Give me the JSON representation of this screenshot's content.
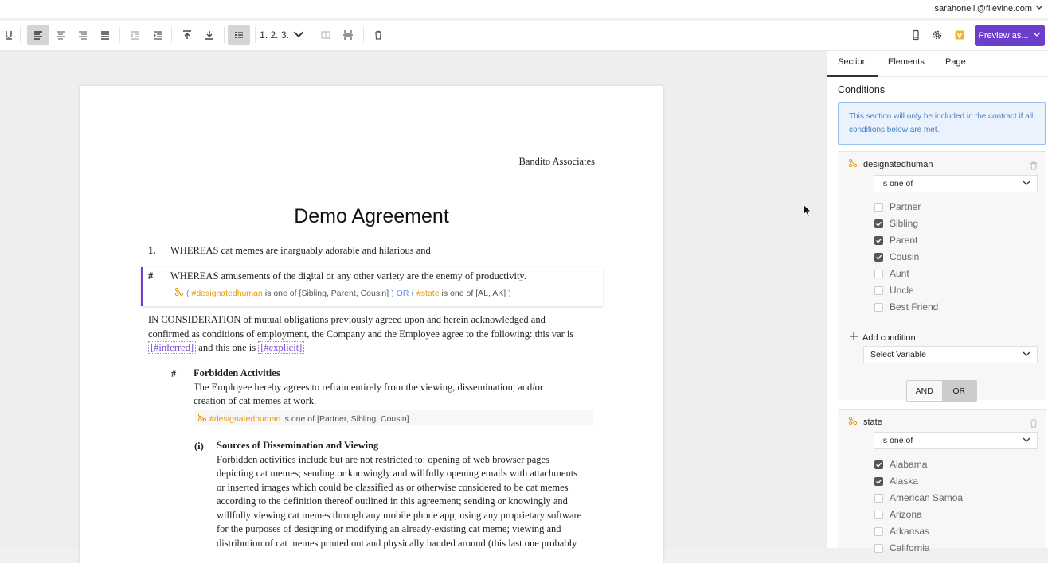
{
  "topbar": {
    "user_email": "sarahoneill@filevine.com"
  },
  "toolbar": {
    "list_style": "1. 2. 3.",
    "preview_label": "Preview as...",
    "accent": "#6b3fc9"
  },
  "document": {
    "company": "Bandito Associates",
    "title": "Demo Agreement",
    "p1_num": "1.",
    "p1_text": "WHEREAS cat memes are inarguably adorable and hilarious and",
    "p2_num": "#",
    "p2_text": "WHEREAS amusements of the digital or any other variety are the enemy of productivity.",
    "p2_cond": {
      "open": "(",
      "var1": "#designatedhuman",
      "op1": "is one of",
      "val1": "[Sibling, Parent, Cousin]",
      "close1": ")",
      "join": "OR",
      "open2": "(",
      "var2": "#state",
      "op2": "is one of",
      "val2": "[AL, AK]",
      "close2": ")"
    },
    "p3_line1": "IN CONSIDERATION of mutual obligations previously agreed upon and herein acknowledged and",
    "p3_line2": "confirmed as conditions of employment, the Company and the Employee agree to the following: this var is",
    "p3_var1": "[#inferred]",
    "p3_mid": "and this one is",
    "p3_var2": "[#explicit]",
    "p4_num": "#",
    "p4_heading": "Forbidden Activities",
    "p4_line1": "The Employee hereby agrees to refrain entirely from the viewing, dissemination, and/or",
    "p4_line2": "creation of cat memes at work.",
    "p4_cond": {
      "var": "#designatedhuman",
      "op": "is one of",
      "val": "[Partner, Sibling, Cousin]"
    },
    "p5_num": "(i)",
    "p5_heading": "Sources of Dissemination and Viewing",
    "p5_lines": [
      "Forbidden activities include but are not restricted to: opening of web browser pages",
      "depicting cat memes; sending or knowingly and willfully opening emails with attachments",
      "or inserted images which could be classified as or otherwise considered to be cat memes",
      "according to the definition thereof outlined in this agreement; sending or knowingly and",
      "willfully viewing cat memes through any mobile phone app; using any proprietary software",
      "for the purposes of designing or modifying an already-existing cat meme; viewing and",
      "distribution of cat memes printed out and physically handed around (this last one probably"
    ]
  },
  "panel": {
    "tabs": [
      "Section",
      "Elements",
      "Page"
    ],
    "active_tab": "Section",
    "conditions_heading": "Conditions",
    "info_text": "This section will only be included in the contract if all conditions below are met.",
    "cond1": {
      "variable": "designatedhuman",
      "operator": "Is one of",
      "options": [
        {
          "label": "Partner",
          "checked": false
        },
        {
          "label": "Sibling",
          "checked": true
        },
        {
          "label": "Parent",
          "checked": true
        },
        {
          "label": "Cousin",
          "checked": true
        },
        {
          "label": "Aunt",
          "checked": false
        },
        {
          "label": "Uncle",
          "checked": false
        },
        {
          "label": "Best Friend",
          "checked": false
        }
      ]
    },
    "add_condition": "Add condition",
    "select_variable": "Select Variable",
    "and_label": "AND",
    "or_label": "OR",
    "or_selected": true,
    "cond2": {
      "variable": "state",
      "operator": "Is one of",
      "options": [
        {
          "label": "Alabama",
          "checked": true
        },
        {
          "label": "Alaska",
          "checked": true
        },
        {
          "label": "American Samoa",
          "checked": false
        },
        {
          "label": "Arizona",
          "checked": false
        },
        {
          "label": "Arkansas",
          "checked": false
        },
        {
          "label": "California",
          "checked": false
        }
      ]
    }
  }
}
